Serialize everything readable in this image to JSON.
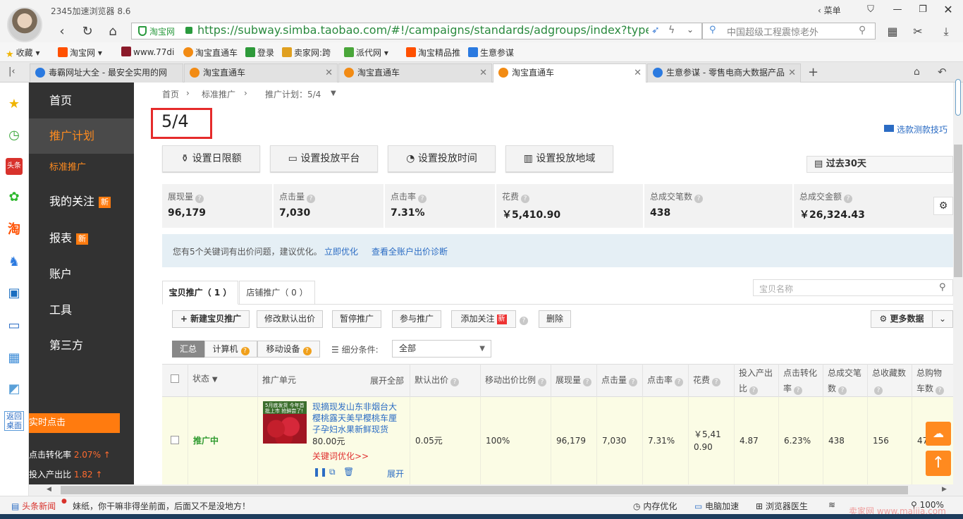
{
  "browser": {
    "title": "2345加速浏览器 8.6",
    "menu_label": "菜单",
    "url": "https://subway.simba.taobao.com/#!/campaigns/standards/adgroups/index?type=item&",
    "secure_label": "淘宝网",
    "search_placeholder": "中国超级工程震惊老外"
  },
  "bookmarks": [
    {
      "label": "收藏",
      "icon": "star-icon"
    },
    {
      "label": "淘宝网",
      "icon": "taobao-icon"
    },
    {
      "label": "www.77di",
      "icon": "site-icon"
    },
    {
      "label": "淘宝直通车",
      "icon": "ztc-icon"
    },
    {
      "label": "登录",
      "icon": "login-icon"
    },
    {
      "label": "卖家网:跨",
      "icon": "seller-icon"
    },
    {
      "label": "派代网",
      "icon": "paidai-icon"
    },
    {
      "label": "淘宝精品推",
      "icon": "taobao-icon"
    },
    {
      "label": "生意参谋",
      "icon": "sycm-icon"
    }
  ],
  "tabs": [
    {
      "label": "毒霸网址大全 - 最安全实用的网"
    },
    {
      "label": "淘宝直通车"
    },
    {
      "label": "淘宝直通车"
    },
    {
      "label": "淘宝直通车",
      "active": true
    },
    {
      "label": "生意参谋 - 零售电商大数据产品"
    }
  ],
  "sidebar": {
    "items": [
      {
        "label": "首页"
      },
      {
        "label": "推广计划",
        "active": true
      },
      {
        "label": "标准推广",
        "sub": true
      },
      {
        "label": "我的关注",
        "badge": "新"
      },
      {
        "label": "报表",
        "badge": "新"
      },
      {
        "label": "账户"
      },
      {
        "label": "工具"
      },
      {
        "label": "第三方"
      }
    ],
    "realtime_title": "实时点击",
    "realtime_rows": [
      {
        "label": "点击转化率",
        "value": "2.07%"
      },
      {
        "label": "投入产出比",
        "value": "1.82"
      }
    ]
  },
  "dock": {
    "back_label_1": "返回",
    "back_label_2": "桌面"
  },
  "main": {
    "breadcrumb": [
      "首页",
      "标准推广",
      "推广计划：5/4"
    ],
    "title": "5/4",
    "tips_link": "选款测款技巧",
    "setting_buttons": [
      "设置日限额",
      "设置投放平台",
      "设置投放时间",
      "设置投放地域"
    ],
    "date_range": "过去30天",
    "stats": [
      {
        "label": "展现量",
        "value": "96,179"
      },
      {
        "label": "点击量",
        "value": "7,030"
      },
      {
        "label": "点击率",
        "value": "7.31%"
      },
      {
        "label": "花费",
        "value": "￥5,410.90"
      },
      {
        "label": "总成交笔数",
        "value": "438"
      },
      {
        "label": "总成交金额",
        "value": "￥26,324.43"
      }
    ],
    "notice": {
      "text": "您有5个关键词有出价问题，建议优化。",
      "link1": "立即优化",
      "link2": "查看全账户出价诊断"
    },
    "content_tabs": [
      "宝贝推广（ 1 ）",
      "店铺推广（ 0 ）"
    ],
    "item_search_placeholder": "宝贝名称",
    "actions": [
      "新建宝贝推广",
      "修改默认出价",
      "暂停推广",
      "参与推广",
      "添加关注",
      "删除"
    ],
    "hot_badge": "新",
    "more_data": "更多数据",
    "filters": [
      "汇总",
      "计算机",
      "移动设备"
    ],
    "filter_label": "细分条件:",
    "filter_value": "全部",
    "table": {
      "headers": [
        "状态",
        "推广单元",
        "默认出价",
        "移动出价比例",
        "展现量",
        "点击量",
        "点击率",
        "花费",
        "投入产出比",
        "点击转化率",
        "总成交笔数",
        "总收藏数",
        "总购物车数"
      ],
      "expand_all": "展开全部",
      "row": {
        "status": "推广中",
        "title": "现摘现发山东非烟台大樱桃露天美早樱桃车厘子孕妇水果新鲜现货",
        "price": "80.00元",
        "kw_link": "关键词优化>>",
        "expand": "展开",
        "thumb_text": "5月底发货 今年首批上市 抢鲜尝了!",
        "bid": "0.05元",
        "mobile_ratio": "100%",
        "impressions": "96,179",
        "clicks": "7,030",
        "ctr": "7.31%",
        "cost": "￥5,410.90",
        "roi": "4.87",
        "cvr": "6.23%",
        "orders": "438",
        "favorites": "156",
        "cart": "47"
      }
    }
  },
  "statusbar": {
    "news_label": "头条新闻",
    "news_text": "妹纸，你干嘛非得坐前面，后面又不是没地方！",
    "items": [
      "内存优化",
      "电脑加速",
      "浏览器医生"
    ],
    "zoom": "100%",
    "watermark": "卖家网 www.maijia.com"
  }
}
